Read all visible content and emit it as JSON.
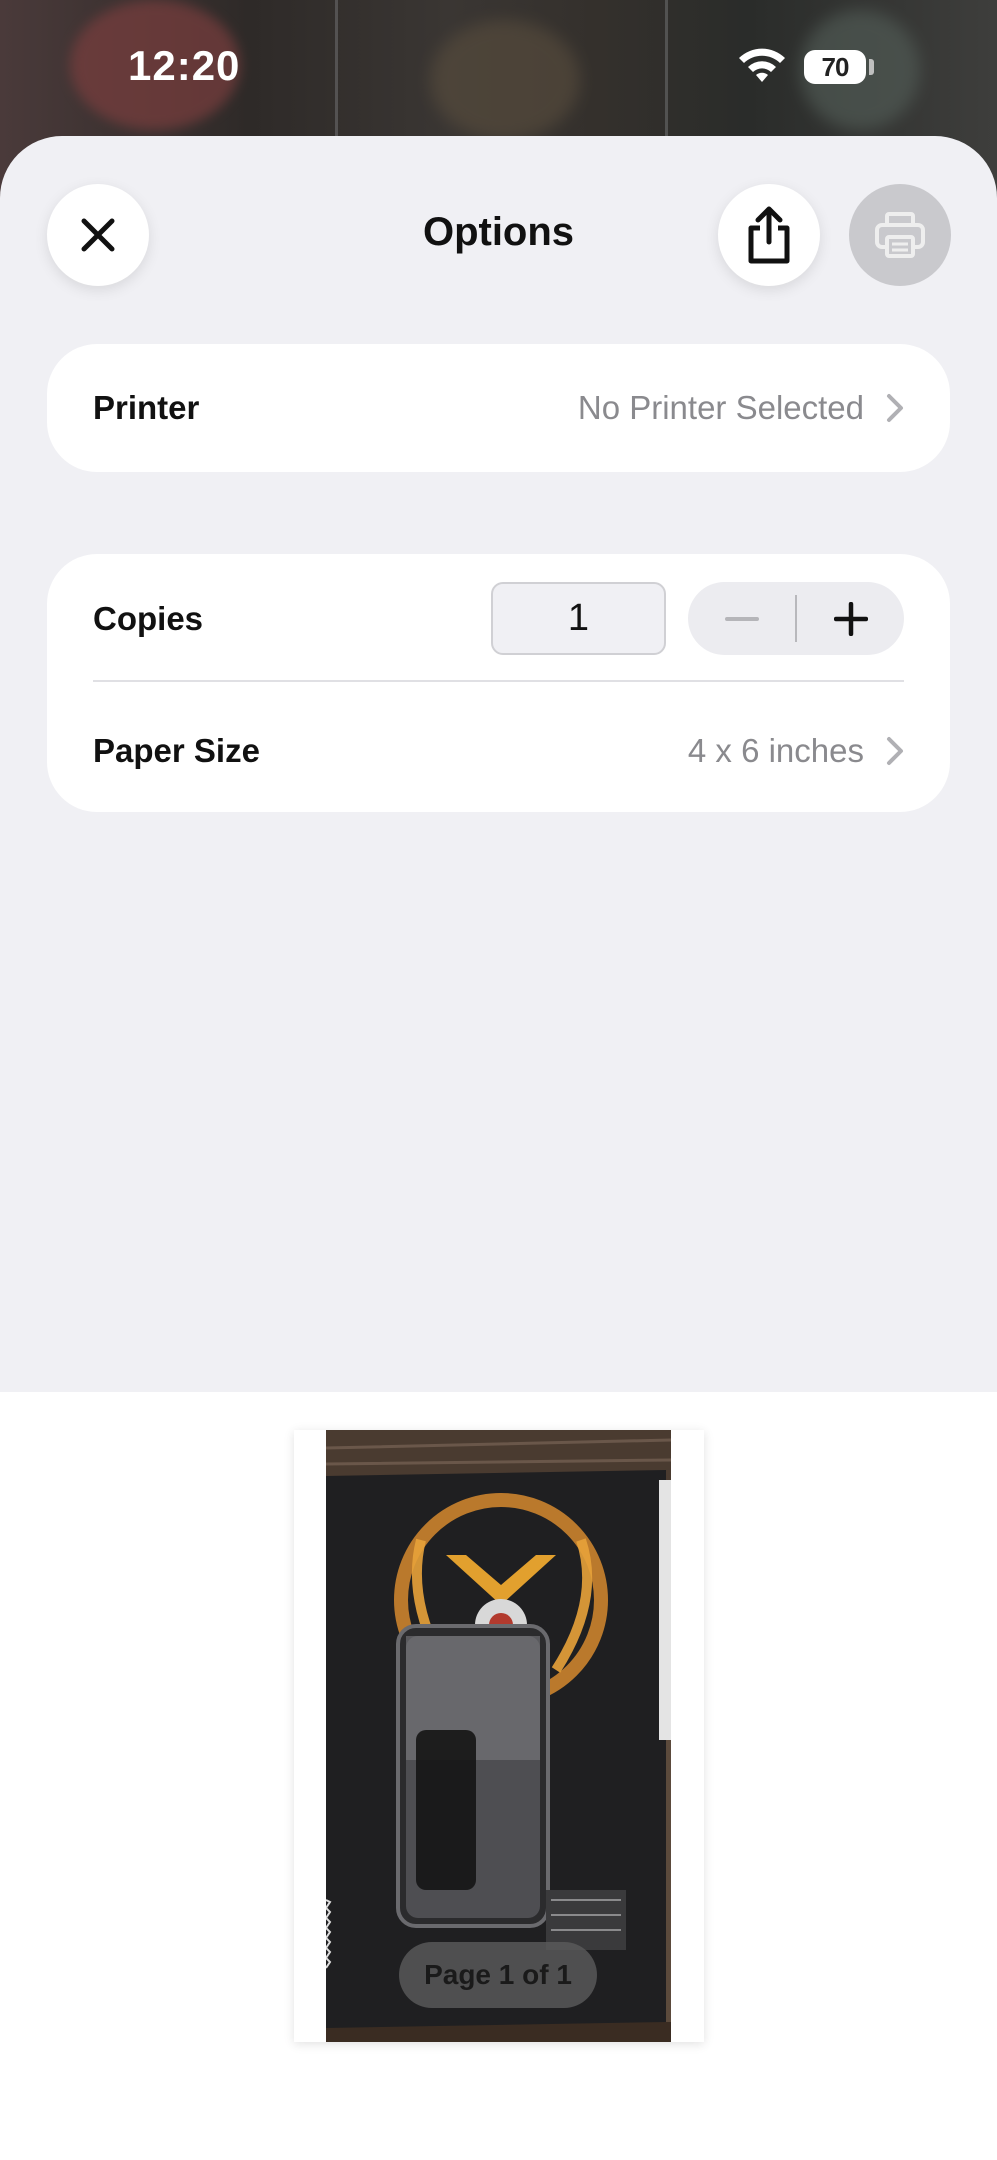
{
  "status_bar": {
    "time": "12:20",
    "battery_level": "70"
  },
  "sheet": {
    "title": "Options",
    "close_icon": "close-icon",
    "share_icon": "share-icon",
    "print_icon": "printer-icon"
  },
  "printer_row": {
    "label": "Printer",
    "value": "No Printer Selected"
  },
  "copies_row": {
    "label": "Copies",
    "value": "1",
    "decrement_icon": "minus-icon",
    "increment_icon": "plus-icon"
  },
  "paper_size_row": {
    "label": "Paper Size",
    "value": "4 x 6 inches"
  },
  "preview": {
    "page_indicator": "Page 1 of 1"
  },
  "colors": {
    "sheet_background": "#f0f0f4",
    "card_background": "#ffffff",
    "secondary_text": "#8a8a8e",
    "disabled_button": "#c9c9cd"
  }
}
